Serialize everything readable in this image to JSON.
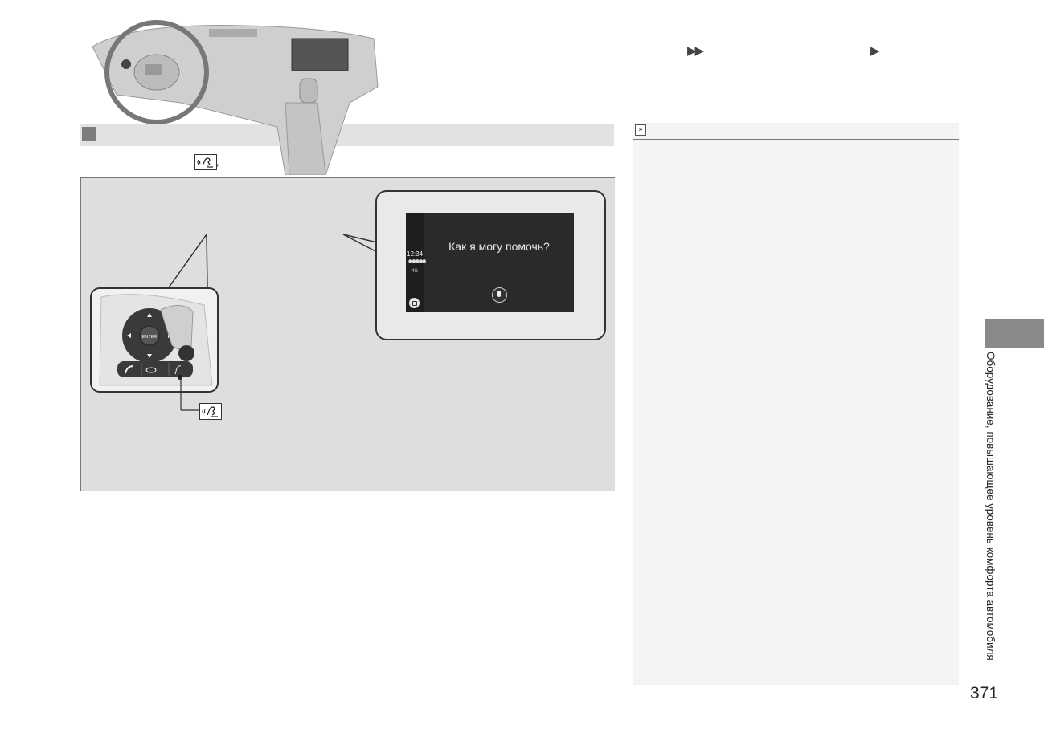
{
  "header": {
    "nav_double_arrow": "▶▶",
    "nav_single_arrow": "▶"
  },
  "content": {
    "inline_comma": ","
  },
  "screen": {
    "time": "12:34",
    "signal": "●●●●●",
    "network": "4G",
    "prompt": "Как я могу помочь?"
  },
  "wheel_controls": {
    "enter_label": "ENTER"
  },
  "sidebar": {
    "chevron": "»"
  },
  "side_tab": {
    "label": "Оборудование, повышающее уровень комфорта автомобиля"
  },
  "footer": {
    "page_number": "371"
  },
  "icons": [
    "talk-button-icon",
    "phone-icon",
    "hang-up-icon",
    "home-icon",
    "microphone-icon",
    "enter-button"
  ],
  "colors": {
    "section_bar": "#e2e2e2",
    "figure_bg": "#dedede",
    "side_tab": "#8a8a8a",
    "screen_bg": "#2a2a2a"
  }
}
